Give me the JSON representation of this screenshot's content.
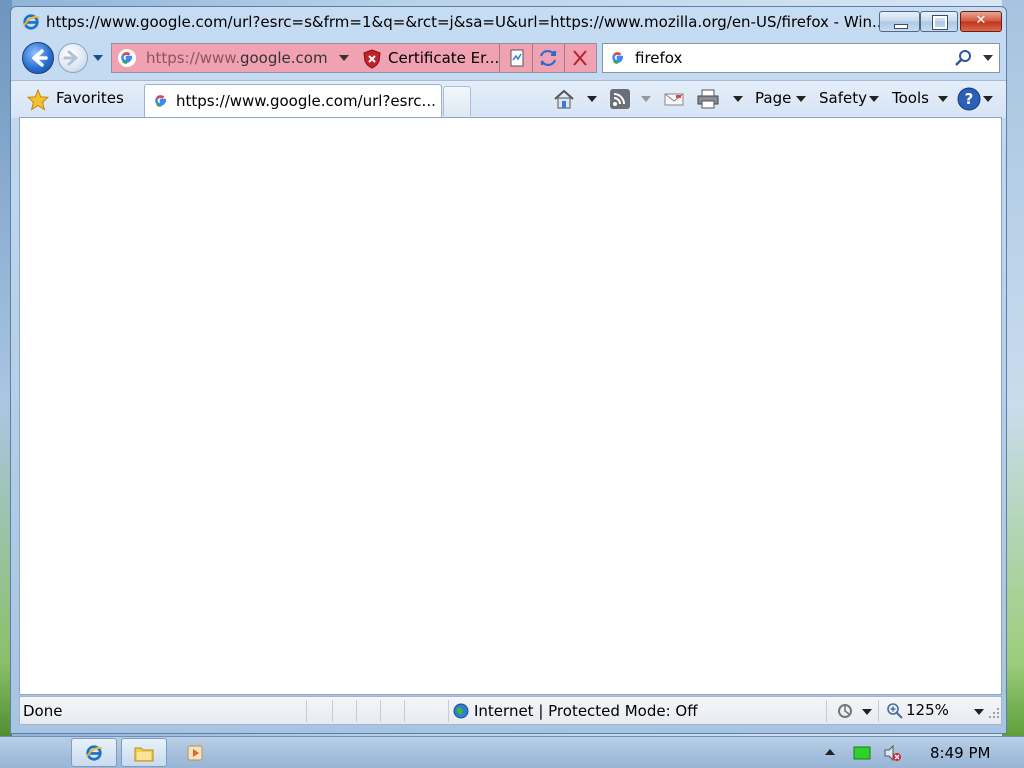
{
  "window": {
    "title": "https://www.google.com/url?esrc=s&frm=1&q=&rct=j&sa=U&url=https://www.mozilla.org/en-US/firefox - Win..."
  },
  "address_bar": {
    "url_prefix": "https://www.",
    "url_domain": "google.com",
    "certificate_label": "Certificate Er..."
  },
  "search_bar": {
    "value": "firefox"
  },
  "favorites_bar": {
    "favorites_label": "Favorites"
  },
  "tabs": [
    {
      "label": "https://www.google.com/url?esrc..."
    }
  ],
  "command_bar": {
    "page_label": "Page",
    "safety_label": "Safety",
    "tools_label": "Tools"
  },
  "status_bar": {
    "status_text": "Done",
    "zone_text": "Internet | Protected Mode: Off",
    "zoom": "125%"
  },
  "taskbar": {
    "clock": "8:49 PM"
  },
  "colors": {
    "address_error_bg": "#f1a2b2",
    "close_button": "#c0331c",
    "back_button": "#2b6fd0"
  },
  "icons": {
    "title": "ie-icon",
    "back": "back-arrow-icon",
    "forward": "forward-arrow-icon",
    "certificate": "certificate-error-shield-icon",
    "compatibility": "compatibility-view-icon",
    "refresh": "refresh-icon",
    "stop": "stop-icon",
    "search": "search-magnifier-icon",
    "favorites": "favorites-star-icon",
    "home": "home-icon",
    "feeds": "rss-feed-icon",
    "mail": "read-mail-icon",
    "print": "printer-icon",
    "help": "help-icon"
  }
}
